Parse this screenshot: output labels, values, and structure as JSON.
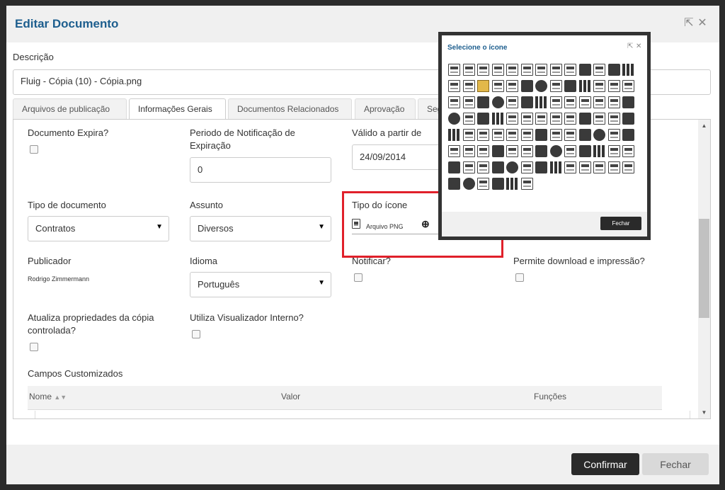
{
  "modal": {
    "title": "Editar Documento",
    "header_icons": [
      "popout-icon",
      "close-icon"
    ]
  },
  "description": {
    "label": "Descrição",
    "value": "Fluig - Cópia (10) - Cópia.png"
  },
  "tabs": [
    {
      "label": "Arquivos de publicação",
      "active": false
    },
    {
      "label": "Informações Gerais",
      "active": true
    },
    {
      "label": "Documentos Relacionados",
      "active": false
    },
    {
      "label": "Aprovação",
      "active": false
    },
    {
      "label": "Seg",
      "active": false
    }
  ],
  "form": {
    "documento_expira": {
      "label": "Documento Expira?",
      "checked": false
    },
    "periodo": {
      "label": "Periodo de Notificação de Expiração",
      "value": "0"
    },
    "valido": {
      "label": "Válido a partir de",
      "value": "24/09/2014"
    },
    "tipo_documento": {
      "label": "Tipo de documento",
      "value": "Contratos"
    },
    "assunto": {
      "label": "Assunto",
      "value": "Diversos"
    },
    "tipo_icone": {
      "label": "Tipo do ícone",
      "value": "Arquivo PNG"
    },
    "publicador": {
      "label": "Publicador",
      "value": "Rodrigo Zimmermann"
    },
    "idioma": {
      "label": "Idioma",
      "value": "Português"
    },
    "notificar": {
      "label": "Notificar?",
      "checked": false
    },
    "permite_download": {
      "label": "Permite download e impressão?",
      "checked": false
    },
    "atualiza": {
      "label": "Atualiza propriedades da cópia controlada?",
      "checked": false
    },
    "visualizador": {
      "label": "Utiliza Visualizador Interno?",
      "checked": false
    }
  },
  "custom_fields": {
    "label": "Campos Customizados",
    "columns": [
      "Nome",
      "Valor",
      "Funções"
    ]
  },
  "footer": {
    "confirm": "Confirmar",
    "close": "Fechar"
  },
  "icon_picker": {
    "title": "Selecione o ícone",
    "close_button": "Fechar",
    "selected_color": "#e2b84a"
  }
}
